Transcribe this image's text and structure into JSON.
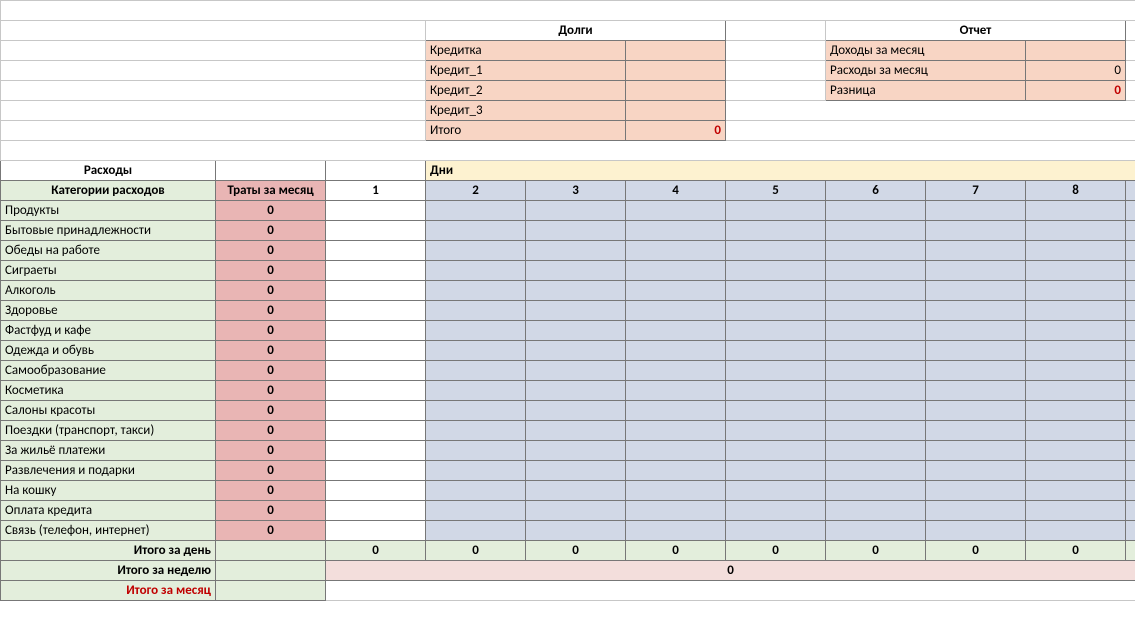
{
  "debts": {
    "title": "Долги",
    "rows": [
      {
        "label": "Кредитка",
        "value": ""
      },
      {
        "label": "Кредит_1",
        "value": ""
      },
      {
        "label": "Кредит_2",
        "value": ""
      },
      {
        "label": "Кредит_3",
        "value": ""
      }
    ],
    "total_label": "Итого",
    "total_value": "0"
  },
  "report": {
    "title": "Отчет",
    "rows": [
      {
        "label": "Доходы за месяц",
        "value": ""
      },
      {
        "label": "Расходы за месяц",
        "value": "0"
      },
      {
        "label": "Разница",
        "value": "0",
        "highlight": true
      }
    ]
  },
  "expenses": {
    "title": "Расходы",
    "cat_header": "Категории расходов",
    "month_header": "Траты за месяц",
    "days_header": "Дни",
    "days": [
      "1",
      "2",
      "3",
      "4",
      "5",
      "6",
      "7",
      "8"
    ],
    "categories": [
      "Продукты",
      "Бытовые принадлежности",
      "Обеды на работе",
      "Сиграеты",
      "Алкоголь",
      "Здоровье",
      "Фастфуд и кафе",
      "Одежда и обувь",
      "Самообразование",
      "Косметика",
      "Салоны красоты",
      "Поездки (транспорт, такси)",
      "За жильё платежи",
      "Развлечения и подарки",
      "На кошку",
      "Оплата кредита",
      "Связь (телефон, интернет)"
    ],
    "month_totals": [
      "0",
      "0",
      "0",
      "0",
      "0",
      "0",
      "0",
      "0",
      "0",
      "0",
      "0",
      "0",
      "0",
      "0",
      "0",
      "0",
      "0"
    ],
    "day_total_label": "Итого за день",
    "day_totals": [
      "0",
      "0",
      "0",
      "0",
      "0",
      "0",
      "0",
      "0"
    ],
    "week_total_label": "Итого за неделю",
    "week_total": "0",
    "month_total_label": "Итого за месяц"
  }
}
